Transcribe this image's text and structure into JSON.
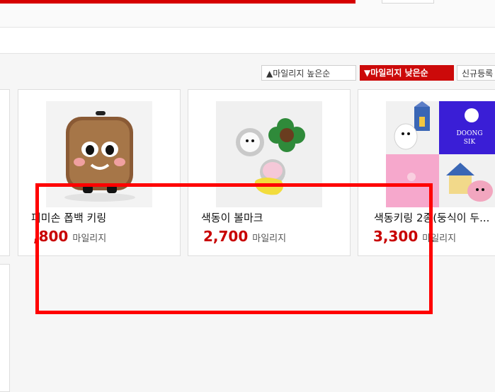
{
  "colors": {
    "accent": "#cc0a0a",
    "price": "#c80000",
    "highlight": "#ff0000"
  },
  "sort_buttons": {
    "high": {
      "icon": "triangle-up-icon",
      "label": "▲마일리지 높은순"
    },
    "low": {
      "icon": "triangle-down-icon",
      "label": "▼마일리지 낮은순"
    },
    "new": {
      "label": "신규등록"
    }
  },
  "products": [
    {
      "name": "피미손 폽백 키링",
      "price": ",800",
      "unit": "마일리지",
      "image": "plush-keyring-image"
    },
    {
      "name": "색동이 볼마크",
      "price": "2,700",
      "unit": "마일리지",
      "image": "ball-mark-image"
    },
    {
      "name": "색동키링 2종(둥식이 두...",
      "price": "3,300",
      "unit": "마일리지",
      "image": "keyring-set-image",
      "image_text": "DOONG SIK"
    }
  ]
}
